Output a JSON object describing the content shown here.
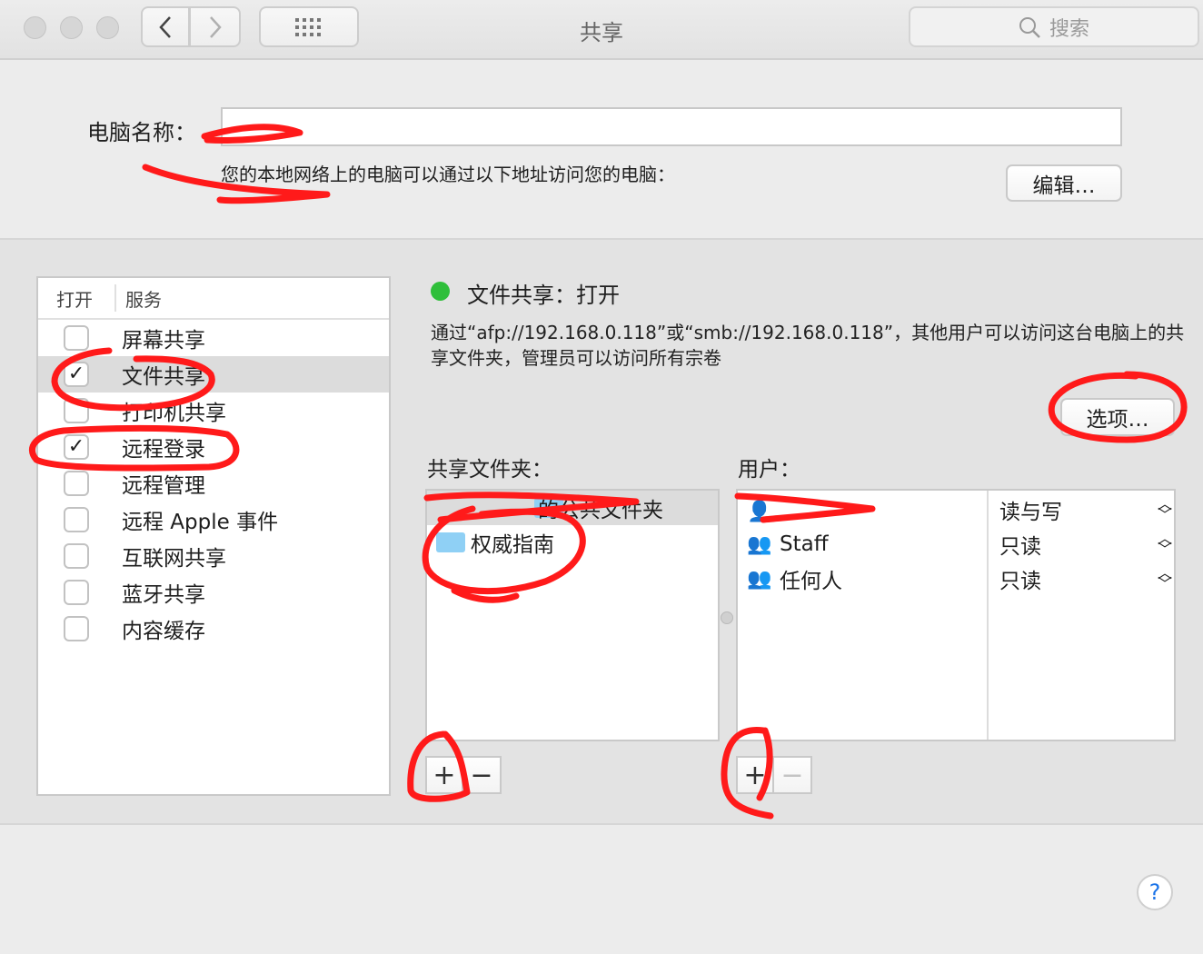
{
  "window": {
    "title": "共享"
  },
  "search": {
    "placeholder": "搜索"
  },
  "computer_name": {
    "label": "电脑名称：",
    "value": "",
    "address_text": "您的本地网络上的电脑可以通过以下地址访问您的电脑：",
    "edit_label": "编辑…"
  },
  "services": {
    "col_on": "打开",
    "col_service": "服务",
    "items": [
      {
        "label": "屏幕共享",
        "checked": false
      },
      {
        "label": "文件共享",
        "checked": true,
        "selected": true
      },
      {
        "label": "打印机共享",
        "checked": false
      },
      {
        "label": "远程登录",
        "checked": true
      },
      {
        "label": "远程管理",
        "checked": false
      },
      {
        "label": "远程 Apple 事件",
        "checked": false
      },
      {
        "label": "互联网共享",
        "checked": false
      },
      {
        "label": "蓝牙共享",
        "checked": false
      },
      {
        "label": "内容缓存",
        "checked": false
      }
    ]
  },
  "status": {
    "text": "文件共享：打开",
    "color": "#2fbf3a",
    "description": "通过“afp://192.168.0.118”或“smb://192.168.0.118”，其他用户可以访问这台电脑上的共享文件夹，管理员可以访问所有宗卷",
    "options_label": "选项…"
  },
  "shared_folders": {
    "label": "共享文件夹：",
    "items": [
      "的公共文件夹",
      "权威指南"
    ]
  },
  "users": {
    "label": "用户：",
    "items": [
      {
        "name": "",
        "permission": "读与写"
      },
      {
        "name": "Staff",
        "permission": "只读"
      },
      {
        "name": "任何人",
        "permission": "只读"
      }
    ]
  },
  "buttons": {
    "add": "+",
    "remove": "−",
    "help": "?"
  },
  "colors": {
    "annotation": "#ff1a1a"
  }
}
